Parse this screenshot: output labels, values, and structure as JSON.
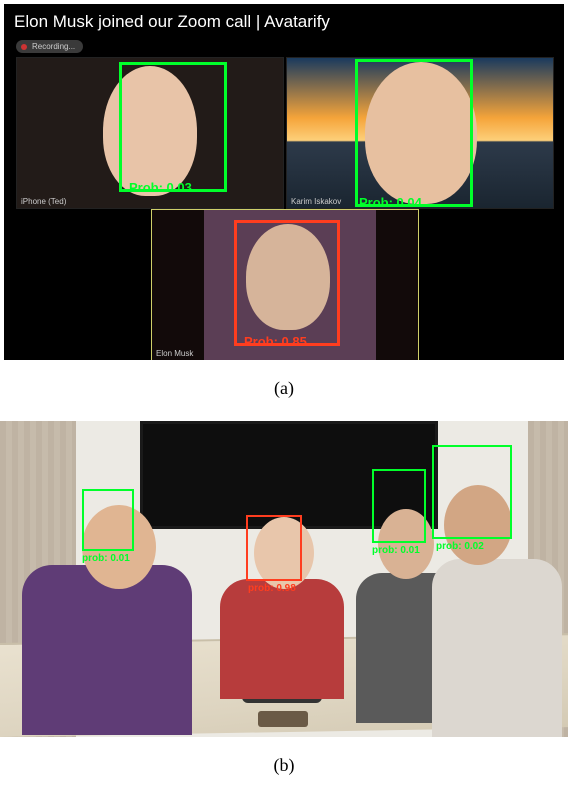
{
  "panel_a": {
    "title": "Elon Musk joined our Zoom call | Avatarify",
    "recording_label": "Recording...",
    "tiles": [
      {
        "name": "iPhone (Ted)",
        "prob_text": "Prob: 0.03",
        "prob": 0.03,
        "color": "green"
      },
      {
        "name": "Karim Iskakov",
        "prob_text": "Prob: 0.04",
        "prob": 0.04,
        "color": "green"
      },
      {
        "name": "Elon Musk",
        "prob_text": "Prob: 0.85",
        "prob": 0.85,
        "color": "red"
      }
    ],
    "caption": "(a)"
  },
  "panel_b": {
    "detections": [
      {
        "prob_text": "prob: 0.01",
        "prob": 0.01,
        "color": "green"
      },
      {
        "prob_text": "prob: 0.98",
        "prob": 0.98,
        "color": "red"
      },
      {
        "prob_text": "prob: 0.01",
        "prob": 0.01,
        "color": "green"
      },
      {
        "prob_text": "prob: 0.02",
        "prob": 0.02,
        "color": "green"
      }
    ],
    "caption": "(b)"
  }
}
